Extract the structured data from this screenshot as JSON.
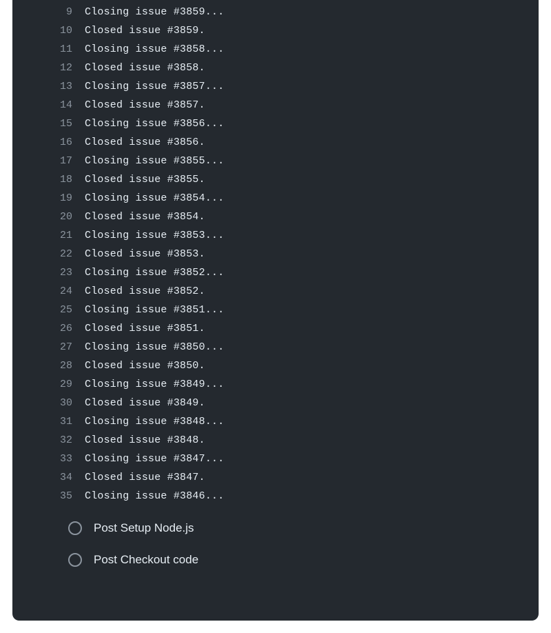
{
  "log_lines": [
    {
      "num": "9",
      "text": "Closing issue #3859..."
    },
    {
      "num": "10",
      "text": "Closed issue #3859."
    },
    {
      "num": "11",
      "text": "Closing issue #3858..."
    },
    {
      "num": "12",
      "text": "Closed issue #3858."
    },
    {
      "num": "13",
      "text": "Closing issue #3857..."
    },
    {
      "num": "14",
      "text": "Closed issue #3857."
    },
    {
      "num": "15",
      "text": "Closing issue #3856..."
    },
    {
      "num": "16",
      "text": "Closed issue #3856."
    },
    {
      "num": "17",
      "text": "Closing issue #3855..."
    },
    {
      "num": "18",
      "text": "Closed issue #3855."
    },
    {
      "num": "19",
      "text": "Closing issue #3854..."
    },
    {
      "num": "20",
      "text": "Closed issue #3854."
    },
    {
      "num": "21",
      "text": "Closing issue #3853..."
    },
    {
      "num": "22",
      "text": "Closed issue #3853."
    },
    {
      "num": "23",
      "text": "Closing issue #3852..."
    },
    {
      "num": "24",
      "text": "Closed issue #3852."
    },
    {
      "num": "25",
      "text": "Closing issue #3851..."
    },
    {
      "num": "26",
      "text": "Closed issue #3851."
    },
    {
      "num": "27",
      "text": "Closing issue #3850..."
    },
    {
      "num": "28",
      "text": "Closed issue #3850."
    },
    {
      "num": "29",
      "text": "Closing issue #3849..."
    },
    {
      "num": "30",
      "text": "Closed issue #3849."
    },
    {
      "num": "31",
      "text": "Closing issue #3848..."
    },
    {
      "num": "32",
      "text": "Closed issue #3848."
    },
    {
      "num": "33",
      "text": "Closing issue #3847..."
    },
    {
      "num": "34",
      "text": "Closed issue #3847."
    },
    {
      "num": "35",
      "text": "Closing issue #3846..."
    }
  ],
  "steps": [
    {
      "label": "Post Setup Node.js",
      "icon": "circle-outline-icon"
    },
    {
      "label": "Post Checkout code",
      "icon": "circle-outline-icon"
    }
  ]
}
